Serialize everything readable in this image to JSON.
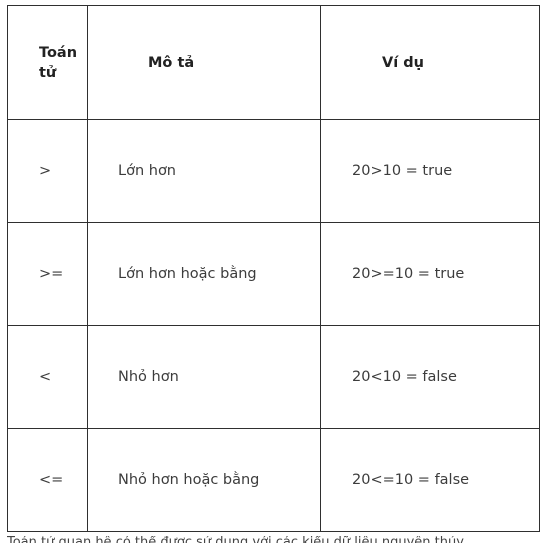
{
  "table": {
    "headers": {
      "operator": "Toán tử",
      "description": "Mô tả",
      "example": "Ví dụ"
    },
    "rows": [
      {
        "operator": ">",
        "description": "Lớn hơn",
        "example": "20>10 = true"
      },
      {
        "operator": ">=",
        "description": "Lớn hơn hoặc bằng",
        "example": "20>=10 = true"
      },
      {
        "operator": "<",
        "description": "Nhỏ hơn",
        "example": "20<10 = false"
      },
      {
        "operator": "<=",
        "description": "Nhỏ hơn hoặc bằng",
        "example": "20<=10 = false"
      }
    ]
  },
  "caption": "Toán tử quan hệ có thể được sử dụng với các kiểu dữ liệu nguyên thủy"
}
